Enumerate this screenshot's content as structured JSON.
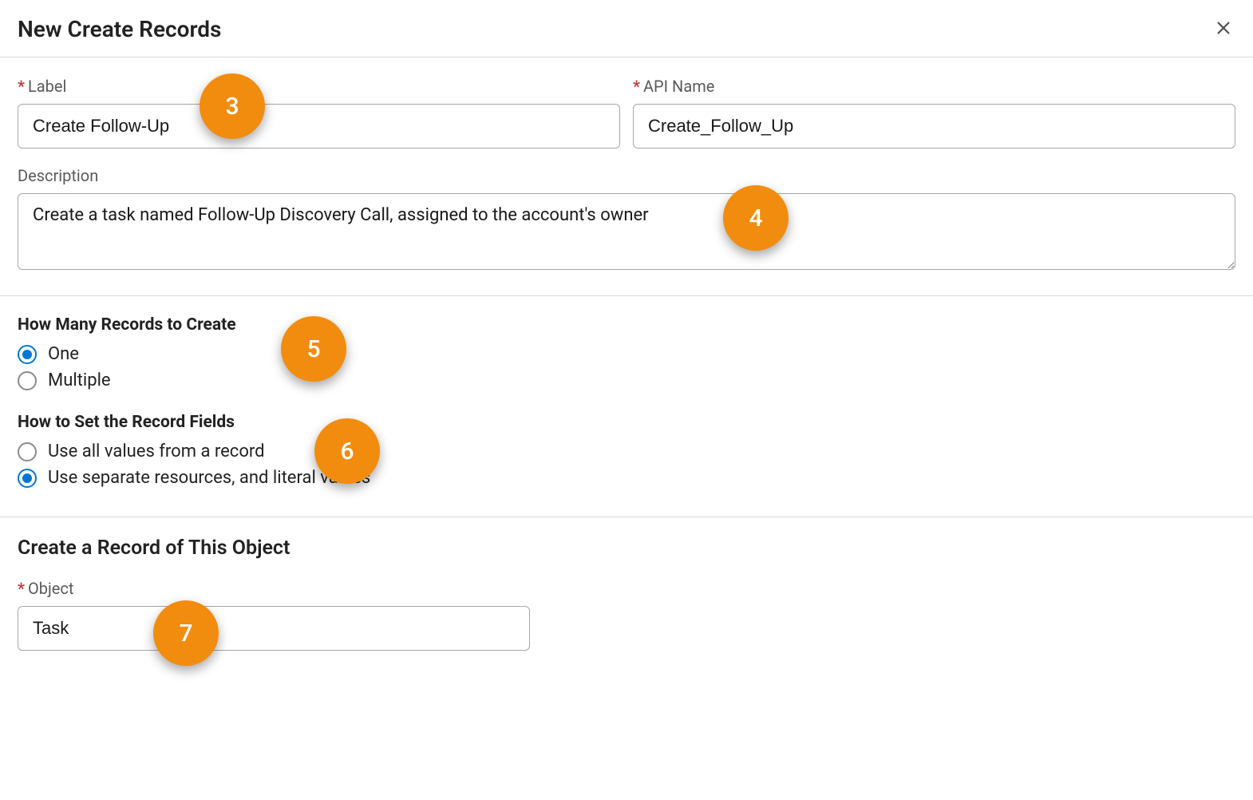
{
  "header": {
    "title": "New Create Records"
  },
  "fields": {
    "label": {
      "label": "Label",
      "value": "Create Follow-Up"
    },
    "apiName": {
      "label": "API Name",
      "value": "Create_Follow_Up"
    },
    "description": {
      "label": "Description",
      "value": "Create a task named Follow-Up Discovery Call, assigned to the account's owner"
    }
  },
  "howMany": {
    "heading": "How Many Records to Create",
    "options": {
      "one": "One",
      "multiple": "Multiple"
    }
  },
  "howSet": {
    "heading": "How to Set the Record Fields",
    "options": {
      "allValues": "Use all values from a record",
      "separate": "Use separate resources, and literal values"
    }
  },
  "objectSection": {
    "heading": "Create a Record of This Object",
    "objectLabel": "Object",
    "objectValue": "Task"
  },
  "callouts": {
    "c3": "3",
    "c4": "4",
    "c5": "5",
    "c6": "6",
    "c7": "7"
  }
}
